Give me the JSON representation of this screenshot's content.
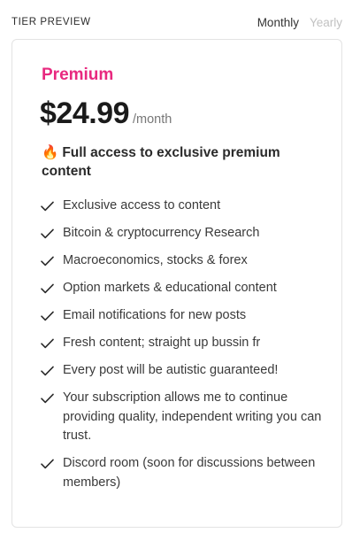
{
  "header": {
    "section_label": "TIER PREVIEW",
    "billing_toggle": {
      "monthly": "Monthly",
      "yearly": "Yearly",
      "selected": "Monthly"
    }
  },
  "tier": {
    "name": "Premium",
    "price": "$24.99",
    "period": "/month",
    "headline_emoji": "🔥",
    "headline": "Full access to exclusive premium content",
    "features": [
      "Exclusive access to content",
      "Bitcoin & cryptocurrency Research",
      "Macroeconomics, stocks & forex",
      "Option markets & educational content",
      "Email notifications for new posts",
      "Fresh content; straight up bussin fr",
      "Every post will be autistic guaranteed!",
      "Your subscription allows me to continue providing quality, independent writing you can trust.",
      "Discord room (soon for discussions between members)"
    ]
  },
  "colors": {
    "accent": "#e8297f",
    "inactive_toggle": "#c2c2c2",
    "border": "#e3e3e3"
  },
  "icons": {
    "feature_bullet": "checkmark-icon",
    "headline": "fire-icon"
  }
}
